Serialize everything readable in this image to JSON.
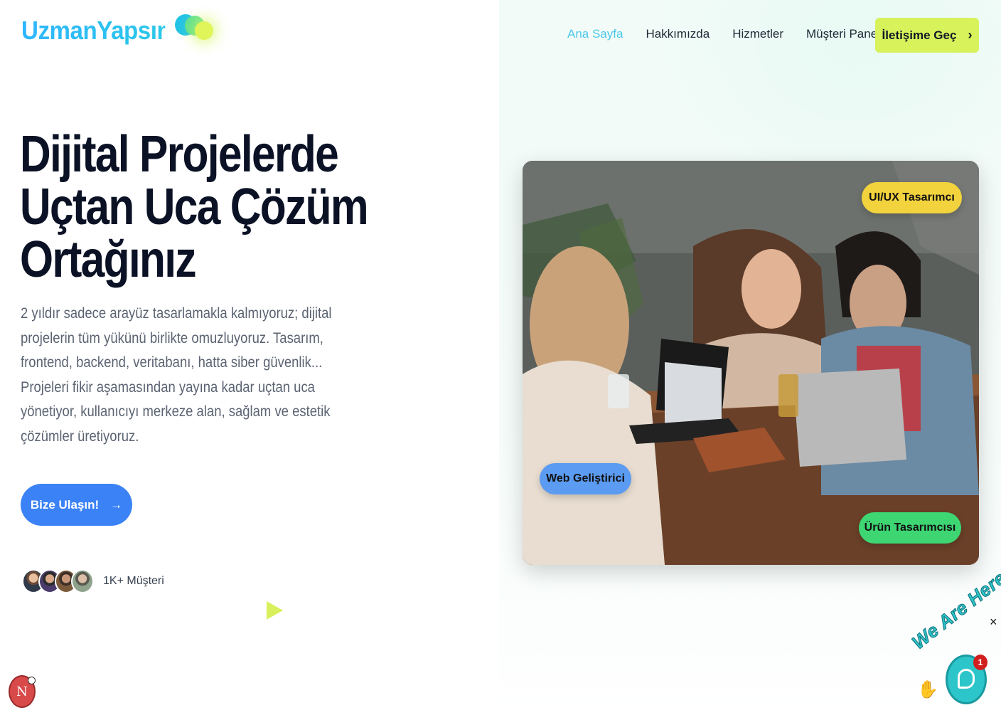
{
  "brand": {
    "name": "UzmanYapsın"
  },
  "nav": {
    "items": [
      {
        "label": "Ana Sayfa",
        "active": true
      },
      {
        "label": "Hakkımızda",
        "active": false
      },
      {
        "label": "Hizmetler",
        "active": false
      },
      {
        "label": "Müşteri Paneli",
        "active": false
      }
    ],
    "cta_label": "İletişime Geç",
    "cta_icon": "chevron-right-icon"
  },
  "hero": {
    "title_lines": [
      "Dijital Projelerde",
      "Uçtan Uca Çözüm",
      "Ortağınız"
    ],
    "description": "2 yıldır sadece arayüz tasarlamakla kalmıyoruz; dijital projelerin tüm yükünü birlikte omuzluyoruz. Tasarım, frontend, backend, veritabanı, hatta siber güvenlik... Projeleri fikir aşamasından yayına kadar uçtan uca yönetiyor, kullanıcıyı merkeze alan, sağlam ve estetik çözümler üretiyoruz.",
    "button_label": "Bize Ulaşın!",
    "button_icon": "arrow-right-icon",
    "customers_label": "1K+ Müşteri"
  },
  "image_badges": {
    "uiux": "UI/UX Tasarımcı",
    "web": "Web Geliştirici",
    "product": "Ürün Tasarımcısı"
  },
  "widgets": {
    "chat_tagline": "We Are Here!",
    "chat_unread": "1",
    "close": "×",
    "n_badge": "N"
  },
  "colors": {
    "accent_lime": "#d7f25a",
    "primary_blue": "#3b82f6",
    "nav_active": "#4cc8e9",
    "badge_yellow": "#f2d33d",
    "badge_blue": "#5b9bf2",
    "badge_green": "#3ed673"
  }
}
